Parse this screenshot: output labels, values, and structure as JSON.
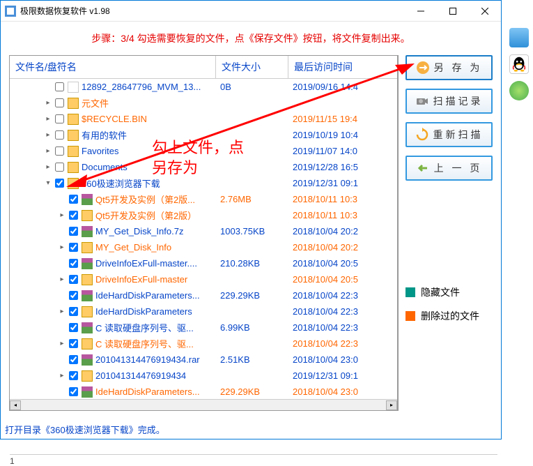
{
  "window": {
    "title": "极限数据恢复软件 v1.98"
  },
  "hint": "步骤：3/4 勾选需要恢复的文件，点《保存文件》按钮，将文件复制出来。",
  "columns": [
    "文件名/盘符名",
    "文件大小",
    "最后访问时间"
  ],
  "rows": [
    {
      "ind": 1,
      "exp": "",
      "chk": false,
      "icon": "doc",
      "name": "12892_28647796_MVM_13...",
      "size": "0B",
      "date": "2019/09/16 14:4",
      "orange": false
    },
    {
      "ind": 1,
      "exp": "▸",
      "chk": false,
      "icon": "fld",
      "name": "元文件",
      "size": "",
      "date": "",
      "orange": true
    },
    {
      "ind": 1,
      "exp": "▸",
      "chk": false,
      "icon": "fld",
      "name": "$RECYCLE.BIN",
      "size": "",
      "date": "2019/11/15 19:4",
      "orange": true
    },
    {
      "ind": 1,
      "exp": "▸",
      "chk": false,
      "icon": "fld",
      "name": "有用的软件",
      "size": "",
      "date": "2019/10/19 10:4",
      "orange": false
    },
    {
      "ind": 1,
      "exp": "▸",
      "chk": false,
      "icon": "fld",
      "name": "Favorites",
      "size": "",
      "date": "2019/11/07 14:0",
      "orange": false
    },
    {
      "ind": 1,
      "exp": "▸",
      "chk": false,
      "icon": "fld",
      "name": "Documents",
      "size": "",
      "date": "2019/12/28 16:5",
      "orange": false
    },
    {
      "ind": 1,
      "exp": "▾",
      "chk": true,
      "icon": "fld",
      "name": "360极速浏览器下载",
      "size": "",
      "date": "2019/12/31 09:1",
      "orange": false
    },
    {
      "ind": 2,
      "exp": "",
      "chk": true,
      "icon": "rar",
      "name": "Qt5开发及实例（第2版...",
      "size": "2.76MB",
      "date": "2018/10/11 10:3",
      "orange": true
    },
    {
      "ind": 2,
      "exp": "▸",
      "chk": true,
      "icon": "fld",
      "name": "Qt5开发及实例（第2版）",
      "size": "",
      "date": "2018/10/11 10:3",
      "orange": true
    },
    {
      "ind": 2,
      "exp": "",
      "chk": true,
      "icon": "rar",
      "name": "MY_Get_Disk_Info.7z",
      "size": "1003.75KB",
      "date": "2018/10/04 20:2",
      "orange": false
    },
    {
      "ind": 2,
      "exp": "▸",
      "chk": true,
      "icon": "fld",
      "name": "MY_Get_Disk_Info",
      "size": "",
      "date": "2018/10/04 20:2",
      "orange": true
    },
    {
      "ind": 2,
      "exp": "",
      "chk": true,
      "icon": "rar",
      "name": "DriveInfoExFull-master....",
      "size": "210.28KB",
      "date": "2018/10/04 20:5",
      "orange": false
    },
    {
      "ind": 2,
      "exp": "▸",
      "chk": true,
      "icon": "fld",
      "name": "DriveInfoExFull-master",
      "size": "",
      "date": "2018/10/04 20:5",
      "orange": true
    },
    {
      "ind": 2,
      "exp": "",
      "chk": true,
      "icon": "rar",
      "name": "IdeHardDiskParameters...",
      "size": "229.29KB",
      "date": "2018/10/04 22:3",
      "orange": false
    },
    {
      "ind": 2,
      "exp": "▸",
      "chk": true,
      "icon": "fld",
      "name": "IdeHardDiskParameters",
      "size": "",
      "date": "2018/10/04 22:3",
      "orange": false
    },
    {
      "ind": 2,
      "exp": "",
      "chk": true,
      "icon": "rar",
      "name": "C   读取硬盘序列号、驱...",
      "size": "6.99KB",
      "date": "2018/10/04 22:3",
      "orange": false
    },
    {
      "ind": 2,
      "exp": "▸",
      "chk": true,
      "icon": "fld",
      "name": "C   读取硬盘序列号、驱...",
      "size": "",
      "date": "2018/10/04 22:3",
      "orange": true
    },
    {
      "ind": 2,
      "exp": "",
      "chk": true,
      "icon": "rar",
      "name": "201041314476919434.rar",
      "size": "2.51KB",
      "date": "2018/10/04 23:0",
      "orange": false
    },
    {
      "ind": 2,
      "exp": "▸",
      "chk": true,
      "icon": "fld",
      "name": "201041314476919434",
      "size": "",
      "date": "2019/12/31 09:1",
      "orange": false
    },
    {
      "ind": 2,
      "exp": "",
      "chk": true,
      "icon": "rar",
      "name": "IdeHardDiskParameters...",
      "size": "229.29KB",
      "date": "2018/10/04 23:0",
      "orange": true
    }
  ],
  "side": {
    "save_as": "另 存 为",
    "scan_log": "扫描记录",
    "rescan": "重新扫描",
    "prev": "上 一 页"
  },
  "legend": {
    "hidden": "隐藏文件",
    "deleted": "删除过的文件"
  },
  "status": "打开目录《360极速浏览器下载》完成。",
  "status2": "1",
  "annotation": "勾上文件，点\n另存为"
}
